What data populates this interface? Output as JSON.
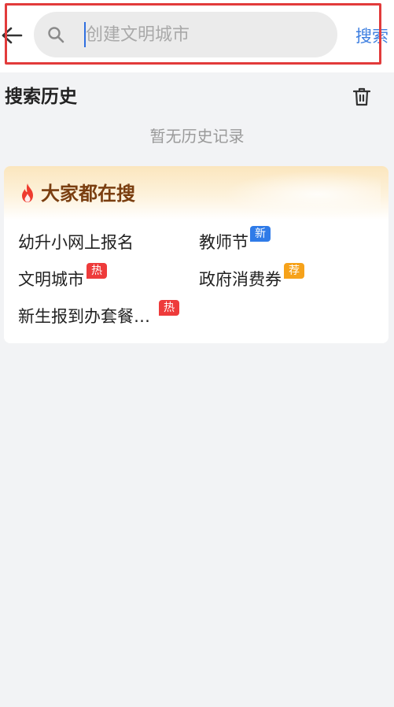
{
  "header": {
    "search_placeholder": "创建文明城市",
    "search_value": "",
    "search_button_label": "搜索"
  },
  "history": {
    "title": "搜索历史",
    "empty_text": "暂无历史记录"
  },
  "hot": {
    "title": "大家都在搜",
    "items": [
      {
        "label": "幼升小网上报名",
        "badge": ""
      },
      {
        "label": "教师节",
        "badge": "新",
        "badge_color": "#2f7be8"
      },
      {
        "label": "文明城市",
        "badge": "热",
        "badge_color": "#ee3b3b"
      },
      {
        "label": "政府消费券",
        "badge": "荐",
        "badge_color": "#f6a21a"
      },
      {
        "label": "新生报到办套餐…",
        "badge": "热",
        "badge_color": "#ee3b3b"
      }
    ]
  },
  "colors": {
    "accent_blue": "#3c7ee0",
    "highlight_red": "#e23b3b",
    "hot_title_brown": "#7a3e10"
  },
  "icons": {
    "back": "arrow-left-icon",
    "search": "magnifier-icon",
    "trash": "trash-icon",
    "flame": "flame-icon"
  }
}
